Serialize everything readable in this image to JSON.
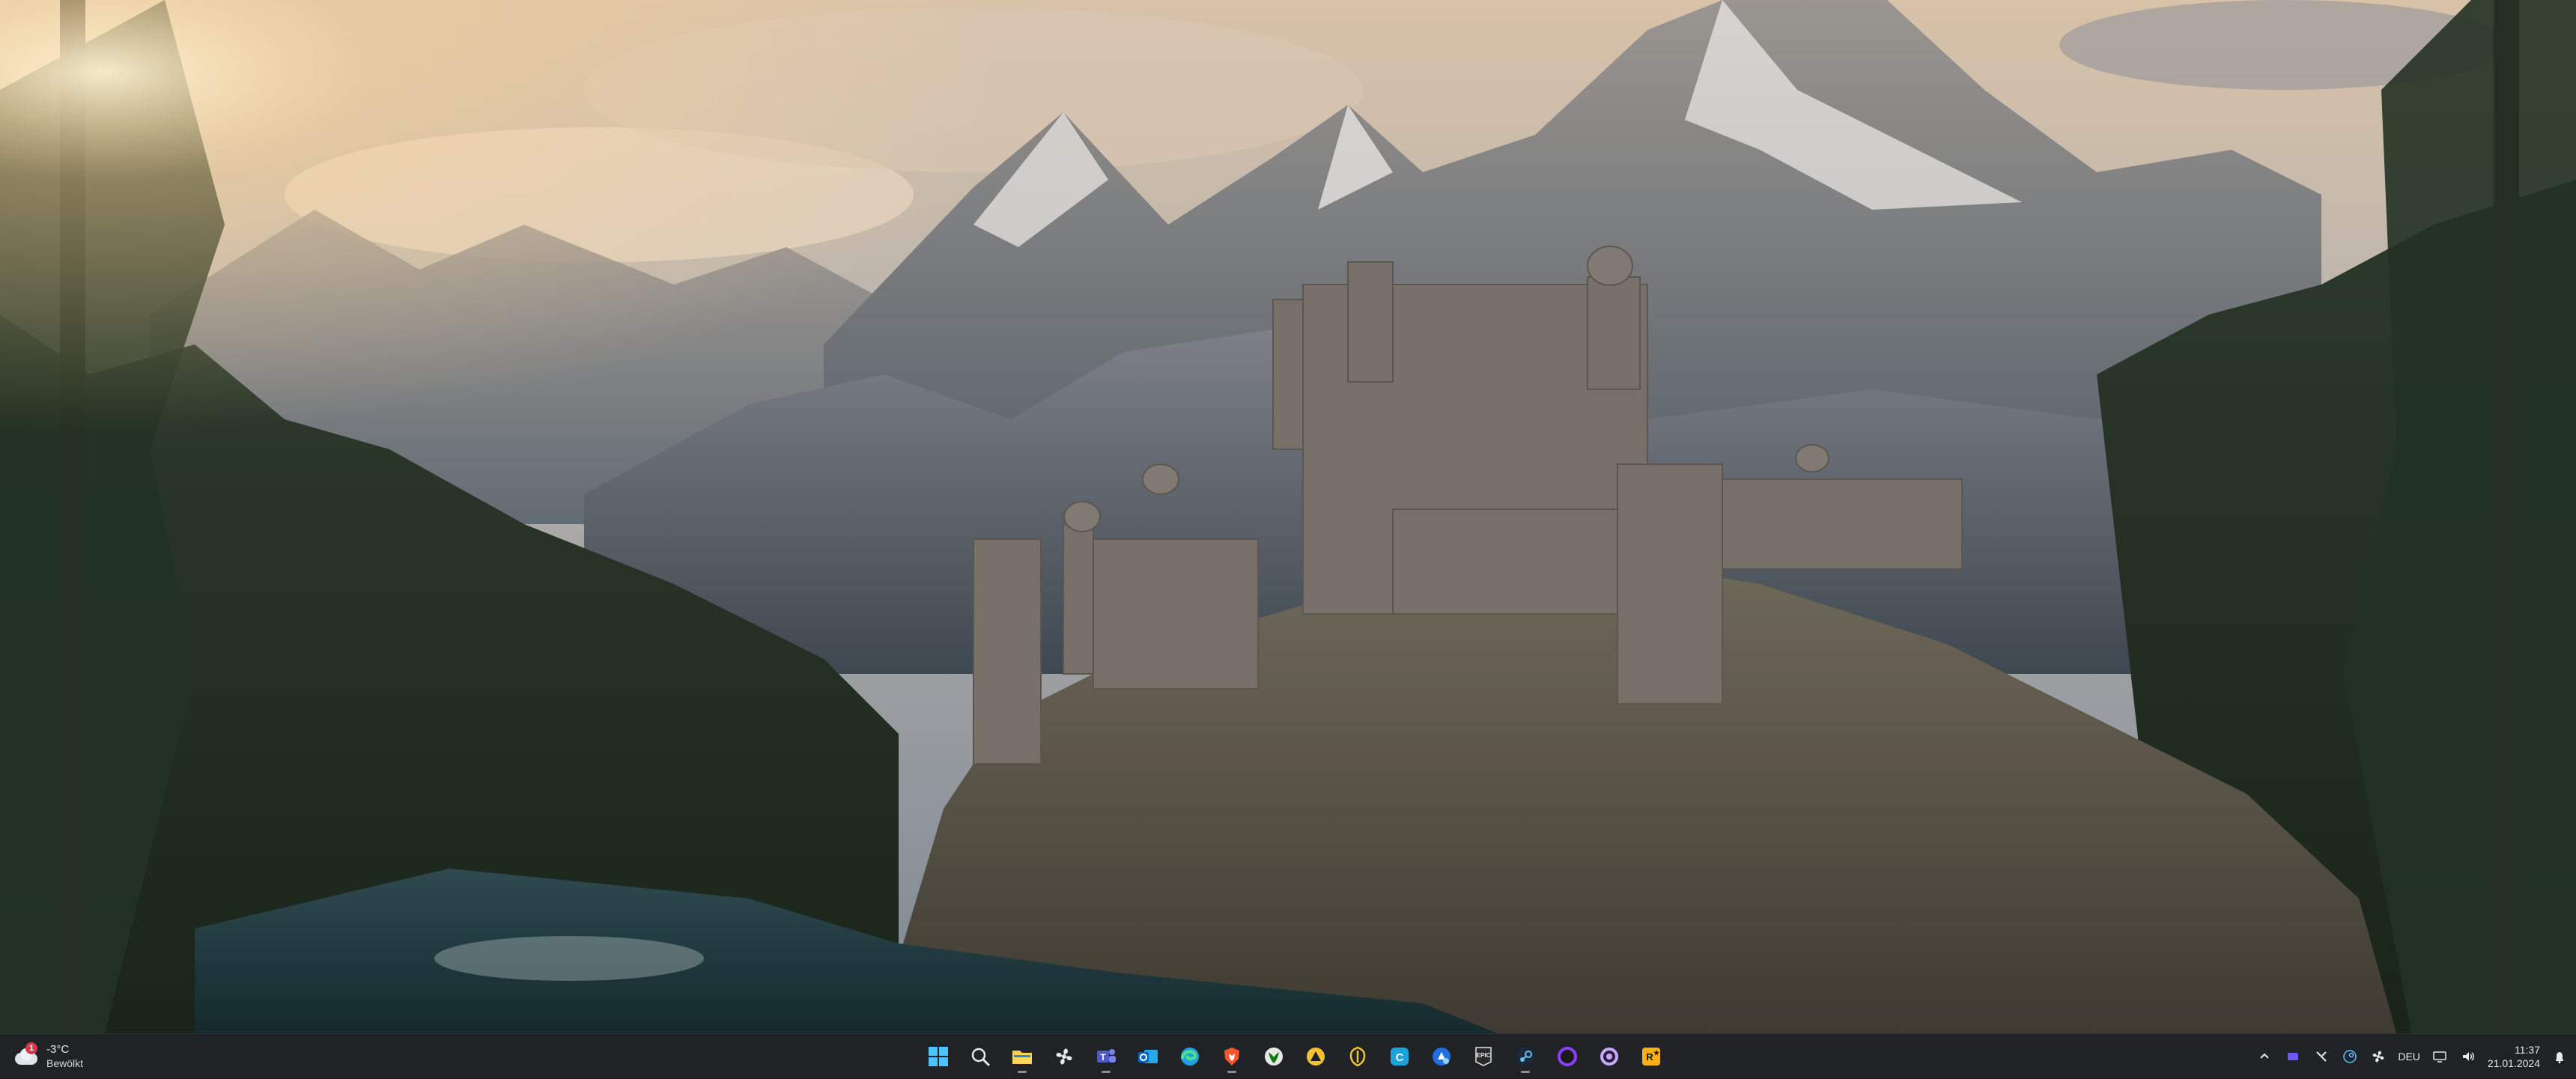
{
  "taskbar": {
    "weather": {
      "temperature": "-3°C",
      "condition": "Bewölkt",
      "notification_count": "1"
    },
    "pinned_apps": [
      {
        "name": "start",
        "icon": "windows-start-icon",
        "state": "idle"
      },
      {
        "name": "search",
        "icon": "search-icon",
        "state": "idle"
      },
      {
        "name": "file-explorer",
        "icon": "folder-icon",
        "state": "running"
      },
      {
        "name": "app-fan",
        "icon": "fan-icon",
        "state": "idle"
      },
      {
        "name": "teams",
        "icon": "teams-icon",
        "state": "running"
      },
      {
        "name": "outlook",
        "icon": "outlook-icon",
        "state": "idle"
      },
      {
        "name": "edge",
        "icon": "edge-icon",
        "state": "idle"
      },
      {
        "name": "brave",
        "icon": "brave-icon",
        "state": "running"
      },
      {
        "name": "xbox",
        "icon": "xbox-icon",
        "state": "idle"
      },
      {
        "name": "app-yellow",
        "icon": "triangle-app-icon",
        "state": "idle"
      },
      {
        "name": "app-yellow-outline",
        "icon": "shield-app-icon",
        "state": "idle"
      },
      {
        "name": "app-c",
        "icon": "c-app-icon",
        "state": "idle"
      },
      {
        "name": "app-blue",
        "icon": "blue-app-icon",
        "state": "idle"
      },
      {
        "name": "epic-games",
        "icon": "epic-games-icon",
        "state": "idle"
      },
      {
        "name": "steam",
        "icon": "steam-icon",
        "state": "running"
      },
      {
        "name": "app-purple-ring",
        "icon": "purple-ring-icon",
        "state": "idle"
      },
      {
        "name": "app-purple-target",
        "icon": "target-app-icon",
        "state": "idle"
      },
      {
        "name": "rockstar",
        "icon": "rockstar-icon",
        "state": "idle"
      }
    ],
    "tray": {
      "language": "DEU",
      "time": "11:37",
      "date": "21.01.2024"
    }
  },
  "colors": {
    "taskbar_bg": "#202326",
    "accent": "#6cc7ff"
  }
}
